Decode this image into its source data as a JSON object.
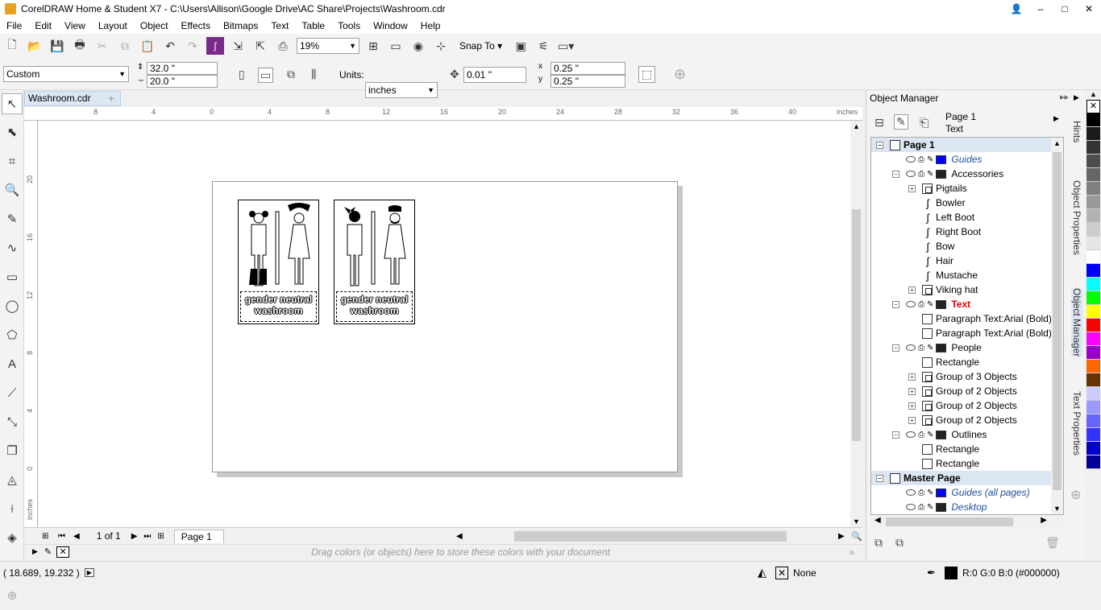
{
  "window": {
    "title": "CorelDRAW Home & Student X7 - C:\\Users\\Allison\\Google Drive\\AC Share\\Projects\\Washroom.cdr",
    "controls": [
      "–",
      "□",
      "✕"
    ]
  },
  "menu": [
    "File",
    "Edit",
    "View",
    "Layout",
    "Object",
    "Effects",
    "Bitmaps",
    "Text",
    "Table",
    "Tools",
    "Window",
    "Help"
  ],
  "standard_toolbar": {
    "zoom": "19%",
    "snap_to": "Snap To"
  },
  "property_bar": {
    "page_preset": "Custom",
    "width": "32.0 \"",
    "height": "20.0 \"",
    "units_label": "Units:",
    "units": "inches",
    "nudge": "0.01 \"",
    "dup_x": "0.25 \"",
    "dup_y": "0.25 \""
  },
  "document": {
    "tab": "Washroom.cdr",
    "ruler_unit": "inches",
    "h_ruler_ticks": [
      "8",
      "4",
      "0",
      "4",
      "8",
      "12",
      "16",
      "20",
      "24",
      "28",
      "32",
      "36",
      "40"
    ],
    "v_ruler_ticks": [
      "20",
      "16",
      "12",
      "8",
      "4",
      "0"
    ],
    "v_ruler_unit": "inches",
    "signs": [
      {
        "caption_line1": "gender neutral",
        "caption_line2": "washroom"
      },
      {
        "caption_line1": "gender neutral",
        "caption_line2": "washroom"
      }
    ]
  },
  "page_nav": {
    "counter": "1 of 1",
    "page_tab": "Page 1"
  },
  "palette_hint": "Drag colors (or objects) here to store these colors with your document",
  "status": {
    "coords": "( 18.689, 19.232 )",
    "fill": "None",
    "outline": "R:0 G:0 B:0 (#000000)"
  },
  "object_manager": {
    "title": "Object Manager",
    "current_page": "Page 1",
    "current_layer": "Text",
    "tree": [
      {
        "kind": "page",
        "label": "Page 1",
        "indent": 0
      },
      {
        "kind": "layer",
        "label": "Guides",
        "indent": 1,
        "color": "#0000ff",
        "style": "italic"
      },
      {
        "kind": "layer",
        "label": "Accessories",
        "indent": 1,
        "color": "#222222",
        "expand": "⊟"
      },
      {
        "kind": "group",
        "label": "Pigtails",
        "indent": 2,
        "expand": "⊞"
      },
      {
        "kind": "curve",
        "label": "Bowler",
        "indent": 2
      },
      {
        "kind": "curve",
        "label": "Left Boot",
        "indent": 2
      },
      {
        "kind": "curve",
        "label": "Right Boot",
        "indent": 2
      },
      {
        "kind": "curve",
        "label": "Bow",
        "indent": 2
      },
      {
        "kind": "curve",
        "label": "Hair",
        "indent": 2
      },
      {
        "kind": "curve",
        "label": "Mustache",
        "indent": 2
      },
      {
        "kind": "group",
        "label": "Viking hat",
        "indent": 2,
        "expand": "⊞"
      },
      {
        "kind": "layer",
        "label": "Text",
        "indent": 1,
        "color": "#222222",
        "expand": "⊟",
        "style": "active"
      },
      {
        "kind": "box",
        "label": "Paragraph Text:Arial (Bold)",
        "indent": 2
      },
      {
        "kind": "box",
        "label": "Paragraph Text:Arial (Bold)",
        "indent": 2
      },
      {
        "kind": "layer",
        "label": "People",
        "indent": 1,
        "color": "#222222",
        "expand": "⊟"
      },
      {
        "kind": "box",
        "label": "Rectangle",
        "indent": 2
      },
      {
        "kind": "group",
        "label": "Group of 3 Objects",
        "indent": 2,
        "expand": "⊞"
      },
      {
        "kind": "group",
        "label": "Group of 2 Objects",
        "indent": 2,
        "expand": "⊞"
      },
      {
        "kind": "group",
        "label": "Group of 2 Objects",
        "indent": 2,
        "expand": "⊞"
      },
      {
        "kind": "group",
        "label": "Group of 2 Objects",
        "indent": 2,
        "expand": "⊞"
      },
      {
        "kind": "layer",
        "label": "Outlines",
        "indent": 1,
        "color": "#222222",
        "expand": "⊟"
      },
      {
        "kind": "box",
        "label": "Rectangle",
        "indent": 2
      },
      {
        "kind": "box",
        "label": "Rectangle",
        "indent": 2
      },
      {
        "kind": "page",
        "label": "Master Page",
        "indent": 0
      },
      {
        "kind": "layer",
        "label": "Guides (all pages)",
        "indent": 1,
        "color": "#0000ff",
        "style": "italic"
      },
      {
        "kind": "layer",
        "label": "Desktop",
        "indent": 1,
        "color": "#222222",
        "style": "italic"
      }
    ]
  },
  "side_tabs": [
    "Hints",
    "Object Properties",
    "Object Manager",
    "Text Properties"
  ],
  "palette_colors": [
    "#000000",
    "#1a1a1a",
    "#333333",
    "#4d4d4d",
    "#666666",
    "#808080",
    "#999999",
    "#b3b3b3",
    "#cccccc",
    "#e6e6e6",
    "#ffffff",
    "#0000ff",
    "#00ffff",
    "#00ff00",
    "#ffff00",
    "#ff0000",
    "#ff00ff",
    "#9900cc",
    "#ff6600",
    "#663300",
    "#ccccff",
    "#9999ff",
    "#6666ff",
    "#3333ff",
    "#0000cc",
    "#000099"
  ]
}
